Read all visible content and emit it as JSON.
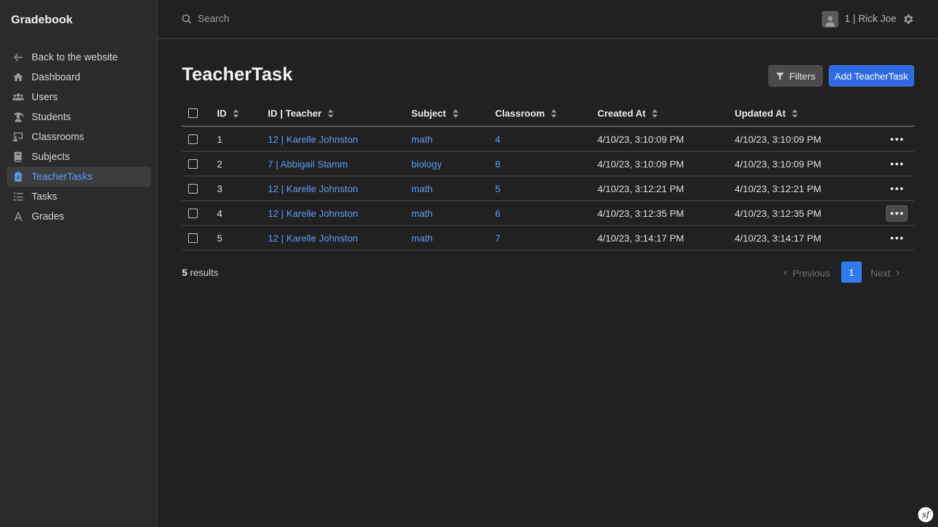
{
  "app": {
    "brand": "Gradebook"
  },
  "sidebar": {
    "items": [
      {
        "label": "Back to the website",
        "icon": "arrow-left-icon",
        "active": false
      },
      {
        "label": "Dashboard",
        "icon": "home-icon",
        "active": false
      },
      {
        "label": "Users",
        "icon": "users-icon",
        "active": false
      },
      {
        "label": "Students",
        "icon": "graduate-icon",
        "active": false
      },
      {
        "label": "Classrooms",
        "icon": "classroom-icon",
        "active": false
      },
      {
        "label": "Subjects",
        "icon": "book-icon",
        "active": false
      },
      {
        "label": "TeacherTasks",
        "icon": "clipboard-icon",
        "active": true
      },
      {
        "label": "Tasks",
        "icon": "tasks-list-icon",
        "active": false
      },
      {
        "label": "Grades",
        "icon": "letter-a-icon",
        "active": false
      }
    ]
  },
  "topbar": {
    "search_placeholder": "Search",
    "user_label": "1 | Rick Joe"
  },
  "main": {
    "title": "TeacherTask",
    "filters_label": "Filters",
    "add_label": "Add TeacherTask"
  },
  "table": {
    "columns": [
      "ID",
      "ID | Teacher",
      "Subject",
      "Classroom",
      "Created At",
      "Updated At"
    ],
    "rows": [
      {
        "id": "1",
        "teacher": "12 | Karelle Johnston",
        "subject": "math",
        "classroom": "4",
        "created": "4/10/23, 3:10:09 PM",
        "updated": "4/10/23, 3:10:09 PM"
      },
      {
        "id": "2",
        "teacher": "7 | Abbigail Stamm",
        "subject": "biology",
        "classroom": "8",
        "created": "4/10/23, 3:10:09 PM",
        "updated": "4/10/23, 3:10:09 PM"
      },
      {
        "id": "3",
        "teacher": "12 | Karelle Johnston",
        "subject": "math",
        "classroom": "5",
        "created": "4/10/23, 3:12:21 PM",
        "updated": "4/10/23, 3:12:21 PM"
      },
      {
        "id": "4",
        "teacher": "12 | Karelle Johnston",
        "subject": "math",
        "classroom": "6",
        "created": "4/10/23, 3:12:35 PM",
        "updated": "4/10/23, 3:12:35 PM"
      },
      {
        "id": "5",
        "teacher": "12 | Karelle Johnston",
        "subject": "math",
        "classroom": "7",
        "created": "4/10/23, 3:14:17 PM",
        "updated": "4/10/23, 3:14:17 PM"
      }
    ]
  },
  "footer": {
    "results_count": "5",
    "results_label": "results",
    "prev_label": "Previous",
    "current_page": "1",
    "next_label": "Next"
  },
  "colors": {
    "accent": "#2e6ae8",
    "link": "#5d9cf5",
    "background": "#212121",
    "sidebar": "#2b2b2b"
  }
}
